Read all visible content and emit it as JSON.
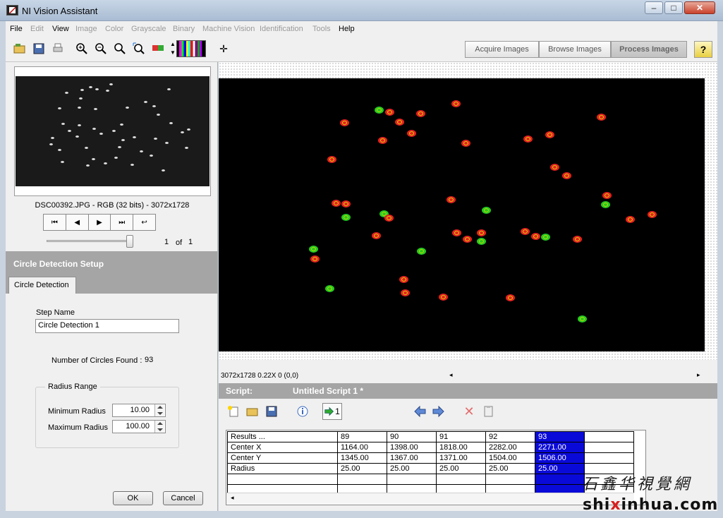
{
  "window": {
    "title": "NI Vision Assistant",
    "minimize": "–",
    "maximize": "□",
    "close": "✕"
  },
  "menu": {
    "items": [
      "File",
      "Edit",
      "View",
      "Image",
      "Color",
      "Grayscale",
      "Binary",
      "Machine Vision",
      "Identification",
      "Tools",
      "Help"
    ]
  },
  "modes": {
    "acquire": "Acquire Images",
    "browse": "Browse Images",
    "process": "Process Images",
    "help": "?"
  },
  "image_browser": {
    "file_info": "DSC00392.JPG - RGB (32 bits) - 3072x1728",
    "page_current": "1",
    "page_of": "of",
    "page_total": "1"
  },
  "setup": {
    "header": "Circle Detection Setup",
    "tab": "Circle Detection",
    "step_name_label": "Step Name",
    "step_name_value": "Circle Detection 1",
    "circles_found_label": "Number of Circles Found :",
    "circles_found_value": "93",
    "radius_group": "Radius Range",
    "min_radius_label": "Minimum Radius",
    "min_radius_value": "10.00",
    "max_radius_label": "Maximum Radius",
    "max_radius_value": "100.00",
    "ok": "OK",
    "cancel": "Cancel"
  },
  "status": {
    "text": "3072x1728 0.22X 0   (0,0)"
  },
  "script": {
    "label": "Script:",
    "name": "Untitled Script 1 *",
    "run_label": "1"
  },
  "results": {
    "header": [
      "Results ...",
      "89",
      "90",
      "91",
      "92",
      "93",
      ""
    ],
    "rows": [
      [
        "Center X",
        "1164.00",
        "1398.00",
        "1818.00",
        "2282.00",
        "2271.00",
        ""
      ],
      [
        "Center Y",
        "1345.00",
        "1367.00",
        "1371.00",
        "1504.00",
        "1506.00",
        ""
      ],
      [
        "Radius",
        "25.00",
        "25.00",
        "25.00",
        "25.00",
        "25.00",
        ""
      ],
      [
        "",
        "",
        "",
        "",
        "",
        "",
        ""
      ],
      [
        "",
        "",
        "",
        "",
        "",
        "",
        ""
      ]
    ]
  },
  "watermark": {
    "cn": "石鑫华視覺網",
    "url_a": "shi",
    "url_b": "x",
    "url_c": "inhua.com"
  },
  "colors": {
    "selection": "#0a0ad8",
    "header_gray": "#a5a5a5",
    "detected_red": "#e82020",
    "detected_green": "#22cc22"
  }
}
